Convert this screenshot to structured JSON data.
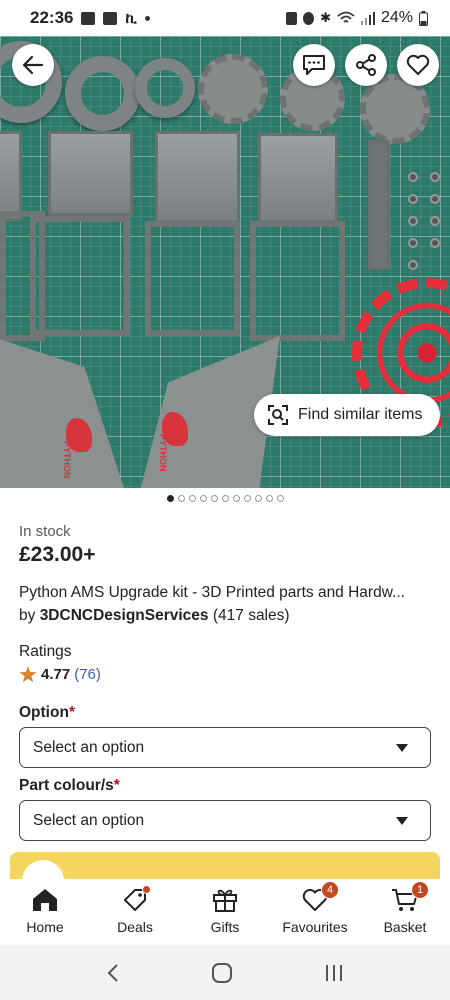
{
  "status_bar": {
    "time": "22:36",
    "battery": "24%"
  },
  "hero": {
    "find_similar_label": "Find similar items",
    "page_count": 11,
    "active_page": 1,
    "engraving_text": "PYTHON"
  },
  "listing": {
    "stock": "In stock",
    "price": "£23.00+",
    "title": "Python AMS Upgrade kit - 3D Printed parts and Hardw...",
    "by_prefix": "by",
    "shop_name": "3DCNCDesignServices",
    "sales": "(417 sales)",
    "ratings_label": "Ratings",
    "rating_score": "4.77",
    "rating_count": "(76)"
  },
  "options": {
    "option_label": "Option",
    "option_required": "*",
    "option_value": "Select an option",
    "colour_label": "Part colour/s",
    "colour_required": "*",
    "colour_value": "Select an option"
  },
  "nav": {
    "items": [
      {
        "label": "Home",
        "icon": "home-icon"
      },
      {
        "label": "Deals",
        "icon": "tag-icon"
      },
      {
        "label": "Gifts",
        "icon": "gift-icon"
      },
      {
        "label": "Favourites",
        "icon": "heart-icon",
        "badge": "4"
      },
      {
        "label": "Basket",
        "icon": "basket-icon",
        "badge": "1"
      }
    ]
  },
  "colors": {
    "accent_badge": "#c4471f",
    "link_blue": "#3c63a8",
    "banner_yellow": "#f6d55f",
    "required_red": "#b3121f"
  }
}
